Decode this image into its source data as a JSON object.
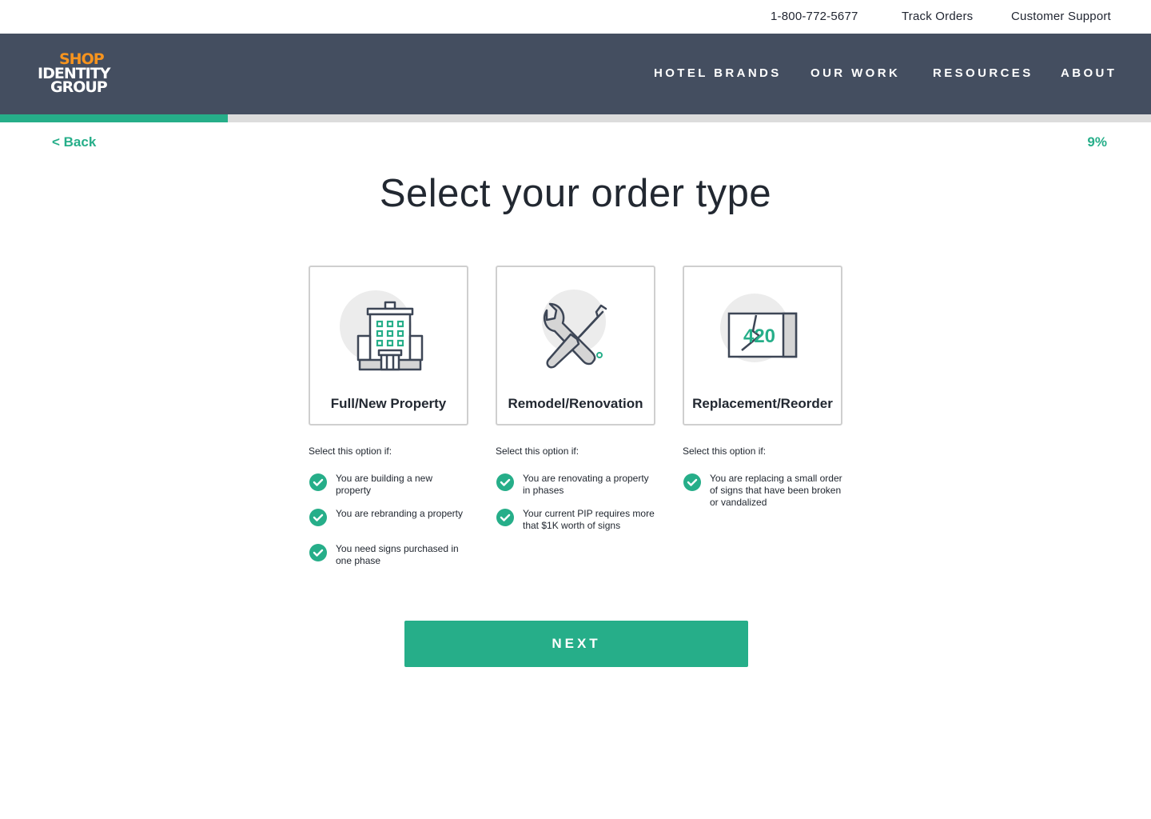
{
  "utility": {
    "phone": "1-800-772-5677",
    "track_orders": "Track Orders",
    "customer_support": "Customer Support"
  },
  "logo": {
    "line1": "SHOP",
    "line2": "IDENTITY",
    "line3": "GROUP"
  },
  "nav": {
    "hotel_brands": "HOTEL BRANDS",
    "our_work": "OUR WORK",
    "resources": "RESOURCES",
    "about": "ABOUT"
  },
  "progress": {
    "fraction": 0.198,
    "label": "9%"
  },
  "back_label": "< Back",
  "title": "Select your order type",
  "options": [
    {
      "label": "Full/New Property",
      "icon": "hotel-building-icon",
      "lead": "Select this option if:",
      "criteria": [
        "You are building a new property",
        "You are rebranding a property",
        "You need signs purchased in one phase"
      ]
    },
    {
      "label": "Remodel/Renovation",
      "icon": "wrench-screwdriver-icon",
      "lead": "Select this option if:",
      "criteria": [
        "You are renovating a property in phases",
        "Your current PIP requires more that $1K worth of signs"
      ]
    },
    {
      "label": "Replacement/Reorder",
      "icon": "broken-sign-icon",
      "sign_number": "420",
      "lead": "Select this option if:",
      "criteria": [
        "You are replacing a small order of signs that have been broken or vandalized"
      ]
    }
  ],
  "next_label": "NEXT",
  "colors": {
    "accent": "#26ae89",
    "header": "#444e60",
    "logo_orange": "#f7941e"
  }
}
